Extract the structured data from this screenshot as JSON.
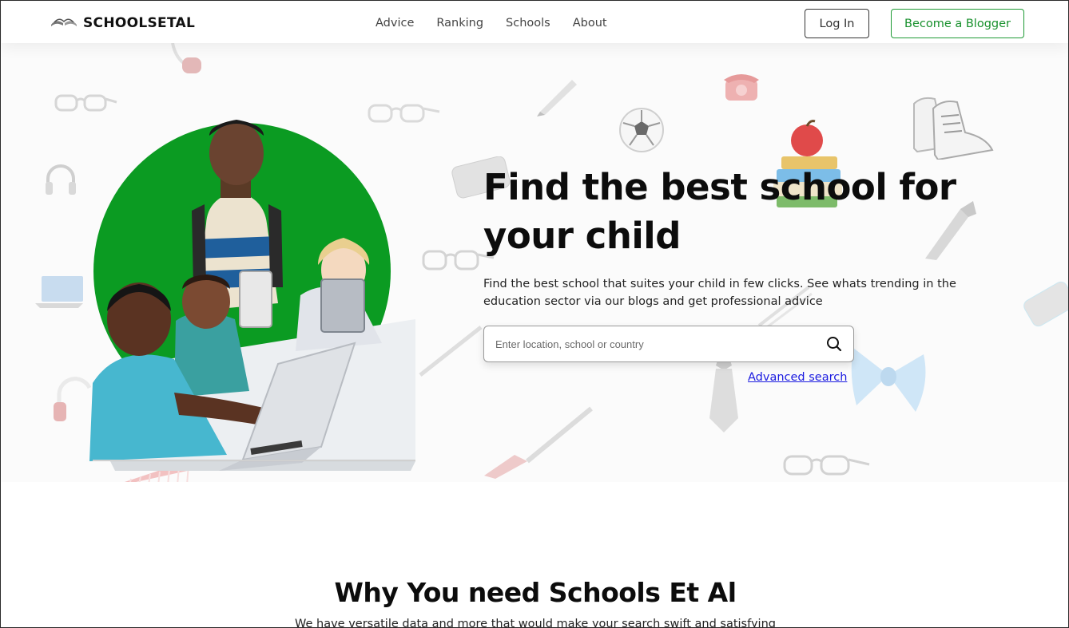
{
  "header": {
    "logo_text": "SCHOOLSETAL",
    "nav": [
      "Advice",
      "Ranking",
      "Schools",
      "About"
    ],
    "login_label": "Log In",
    "blogger_label": "Become a Blogger"
  },
  "hero": {
    "title_line1": "Find the best school for",
    "title_line2": "your child",
    "subtitle": "Find the best school that suites your child in few clicks. See whats trending in the education sector via our blogs and get professional advice",
    "search_placeholder": "Enter location, school or country",
    "advanced_search": "Advanced search"
  },
  "section": {
    "title": "Why You need Schools Et Al",
    "subtitle": "We have versatile data and more that would make your search swift and satisfying"
  },
  "colors": {
    "brand_green": "#0b9b22",
    "button_green": "#17902c",
    "link_blue": "#1a1ae0"
  },
  "icons": [
    "book-logo-icon",
    "search-icon",
    "glasses-icon",
    "headphones-icon",
    "pencil-icon",
    "soccer-ball-icon",
    "sneakers-icon",
    "telephone-icon",
    "apple-books-icon",
    "bowtie-icon",
    "necktie-icon",
    "comb-icon",
    "laptop-icon",
    "phone-icon",
    "brush-icon"
  ]
}
